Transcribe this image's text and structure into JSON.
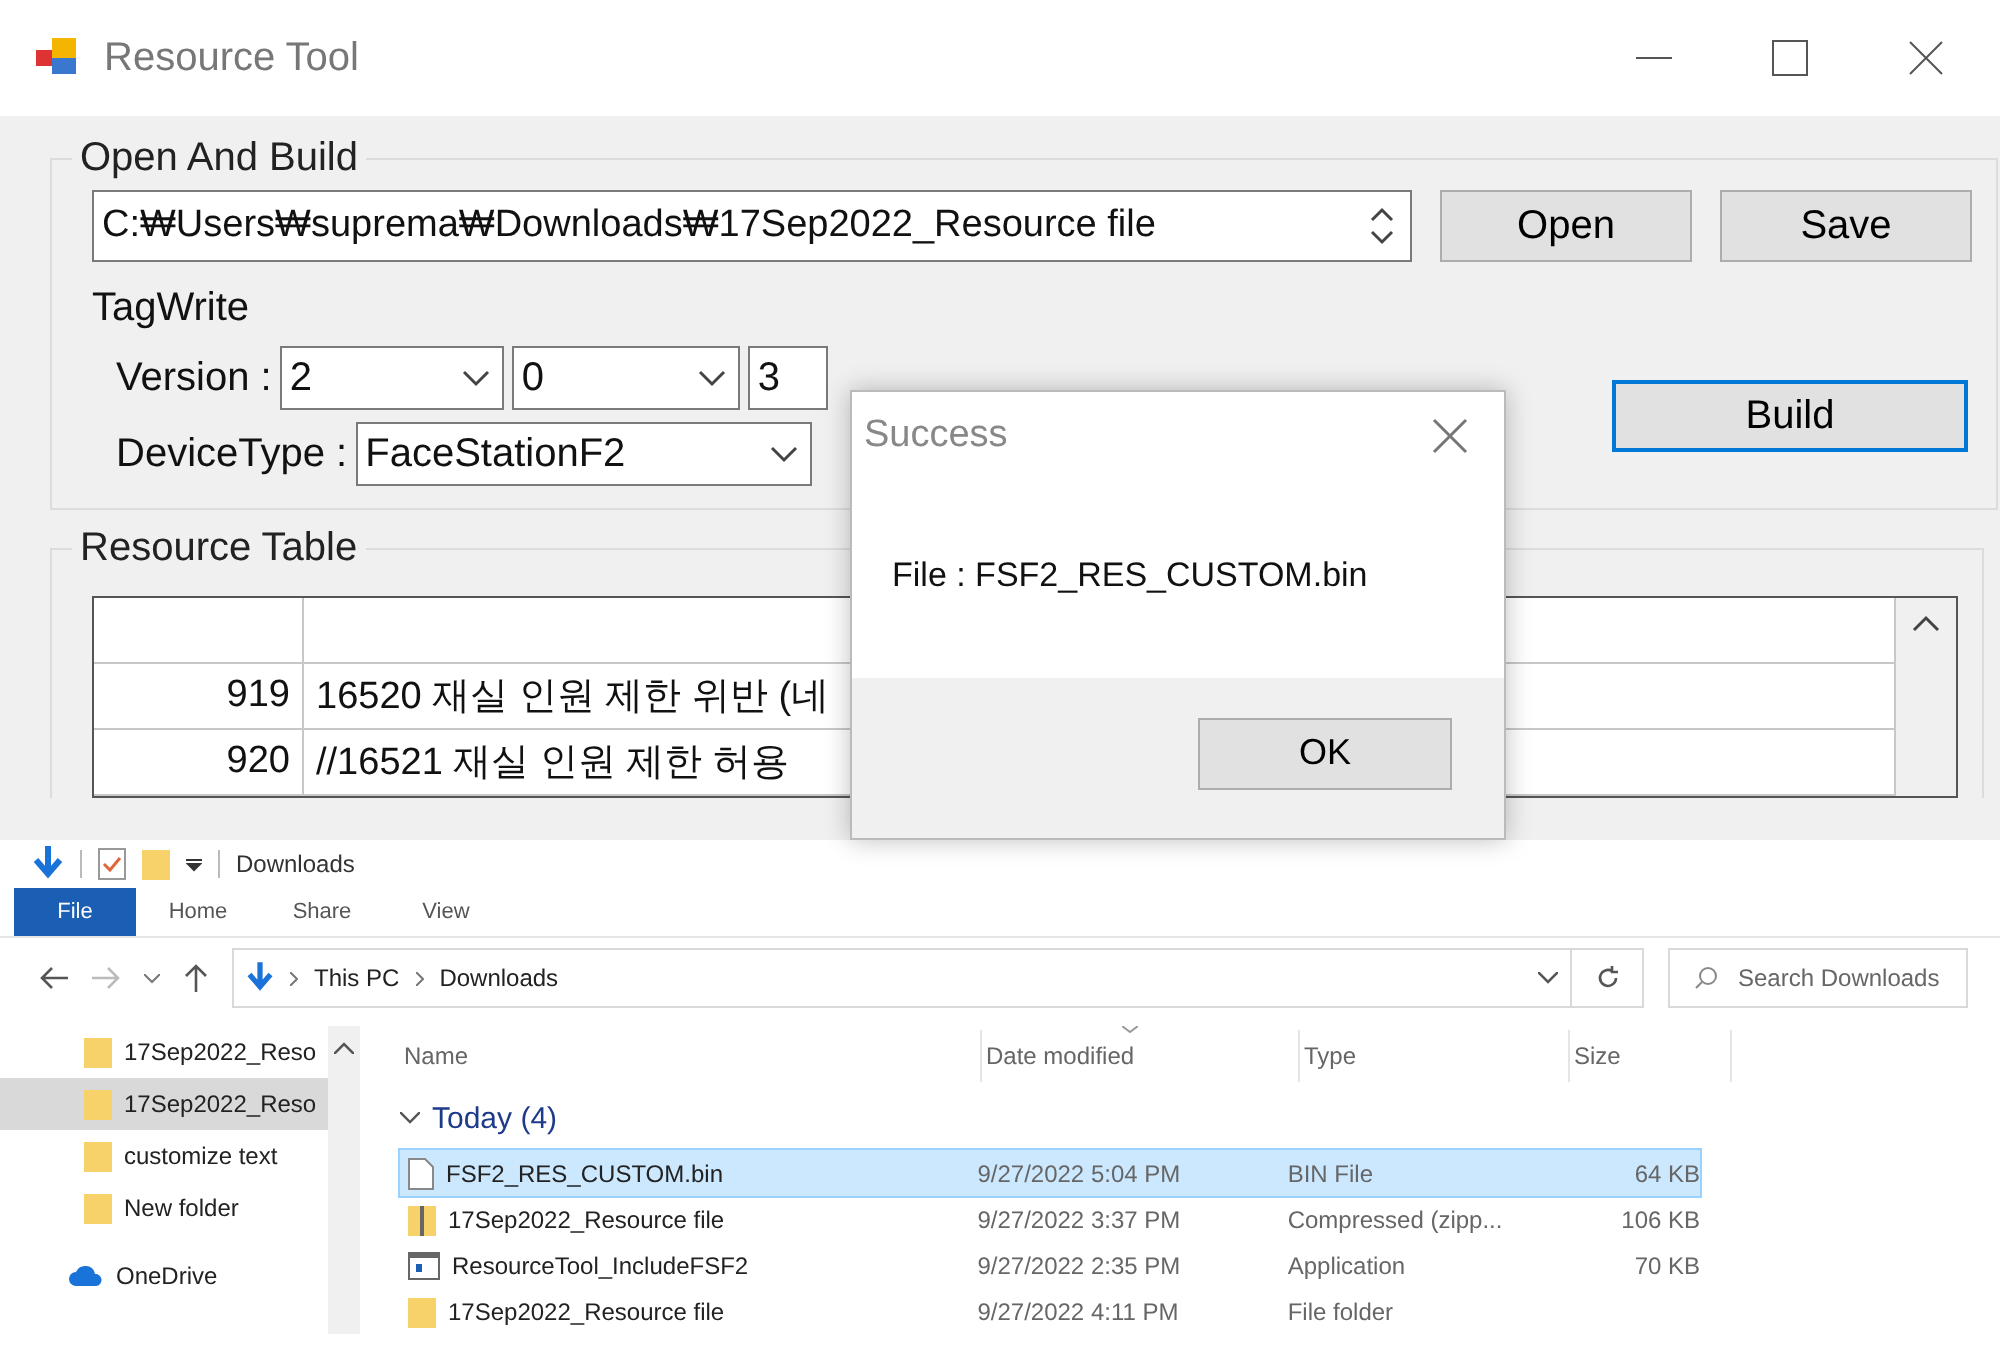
{
  "resource_tool": {
    "title": "Resource Tool",
    "open_and_build": {
      "title": "Open And Build",
      "path": "C:₩Users₩suprema₩Downloads₩17Sep2022_Resource file",
      "buttons": [
        "Open",
        "Save"
      ],
      "tagwrite_label": "TagWrite",
      "version_label": "Version :",
      "version": [
        "2",
        "0",
        "3"
      ],
      "device_type_label": "DeviceType :",
      "device_type": "FaceStationF2",
      "build_button": {
        "label": "Build",
        "focused": true
      }
    },
    "resource_table": {
      "title": "Resource Table",
      "rows": [
        {
          "index": "919",
          "text": "16520 재실 인원 제한 위반 (네"
        },
        {
          "index": "920",
          "text": "//16521 재실 인원 제한 허용"
        }
      ]
    }
  },
  "success_dialog": {
    "title": "Success",
    "message": "File : FSF2_RES_CUSTOM.bin",
    "button": "OK"
  },
  "explorer": {
    "quick_access_title": "Downloads",
    "ribbon_tabs": [
      {
        "label": "File",
        "selected": true
      },
      {
        "label": "Home",
        "selected": false
      },
      {
        "label": "Share",
        "selected": false
      },
      {
        "label": "View",
        "selected": false
      }
    ],
    "breadcrumb": [
      "This PC",
      "Downloads"
    ],
    "search": {
      "placeholder": "Search Downloads"
    },
    "nav_items": [
      {
        "label": "17Sep2022_Reso",
        "kind": "folder",
        "selected": false
      },
      {
        "label": "17Sep2022_Reso",
        "kind": "folder",
        "selected": true
      },
      {
        "label": "customize text",
        "kind": "folder",
        "selected": false
      },
      {
        "label": "New folder",
        "kind": "folder",
        "selected": false
      },
      {
        "label": "OneDrive",
        "kind": "cloud",
        "selected": false
      }
    ],
    "columns": [
      "Name",
      "Date modified",
      "Type",
      "Size"
    ],
    "group": "Today (4)",
    "files": [
      {
        "name": "FSF2_RES_CUSTOM.bin",
        "kind": "file",
        "date": "9/27/2022 5:04 PM",
        "type": "BIN File",
        "size": "64 KB",
        "selected": true
      },
      {
        "name": "17Sep2022_Resource file",
        "kind": "zip",
        "date": "9/27/2022 3:37 PM",
        "type": "Compressed (zipp...",
        "size": "106 KB",
        "selected": false
      },
      {
        "name": "ResourceTool_IncludeFSF2",
        "kind": "app",
        "date": "9/27/2022 2:35 PM",
        "type": "Application",
        "size": "70 KB",
        "selected": false
      },
      {
        "name": "17Sep2022_Resource file",
        "kind": "folder",
        "date": "9/27/2022 4:11 PM",
        "type": "File folder",
        "selected": false
      }
    ]
  }
}
